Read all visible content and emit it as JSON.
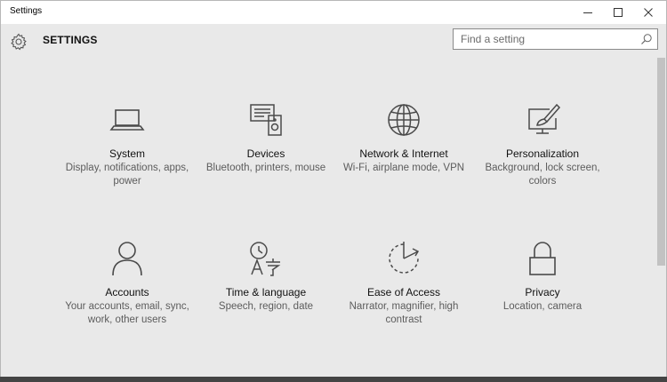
{
  "window": {
    "title": "Settings",
    "minimize_label": "—",
    "maximize_label": "☐",
    "close_label": "✕"
  },
  "header": {
    "title": "SETTINGS",
    "search_placeholder": "Find a setting"
  },
  "tiles": [
    {
      "title": "System",
      "desc": "Display, notifications, apps, power",
      "icon": "laptop-icon"
    },
    {
      "title": "Devices",
      "desc": "Bluetooth, printers, mouse",
      "icon": "devices-icon"
    },
    {
      "title": "Network & Internet",
      "desc": "Wi-Fi, airplane mode, VPN",
      "icon": "globe-icon"
    },
    {
      "title": "Personalization",
      "desc": "Background, lock screen, colors",
      "icon": "paint-icon"
    },
    {
      "title": "Accounts",
      "desc": "Your accounts, email, sync, work, other users",
      "icon": "person-icon"
    },
    {
      "title": "Time & language",
      "desc": "Speech, region, date",
      "icon": "time-language-icon"
    },
    {
      "title": "Ease of Access",
      "desc": "Narrator, magnifier, high contrast",
      "icon": "ease-of-access-icon"
    },
    {
      "title": "Privacy",
      "desc": "Location, camera",
      "icon": "lock-icon"
    }
  ],
  "colors": {
    "background": "#e9e9e9",
    "icon_stroke": "#4a4a4a",
    "title_bar": "#ffffff"
  }
}
